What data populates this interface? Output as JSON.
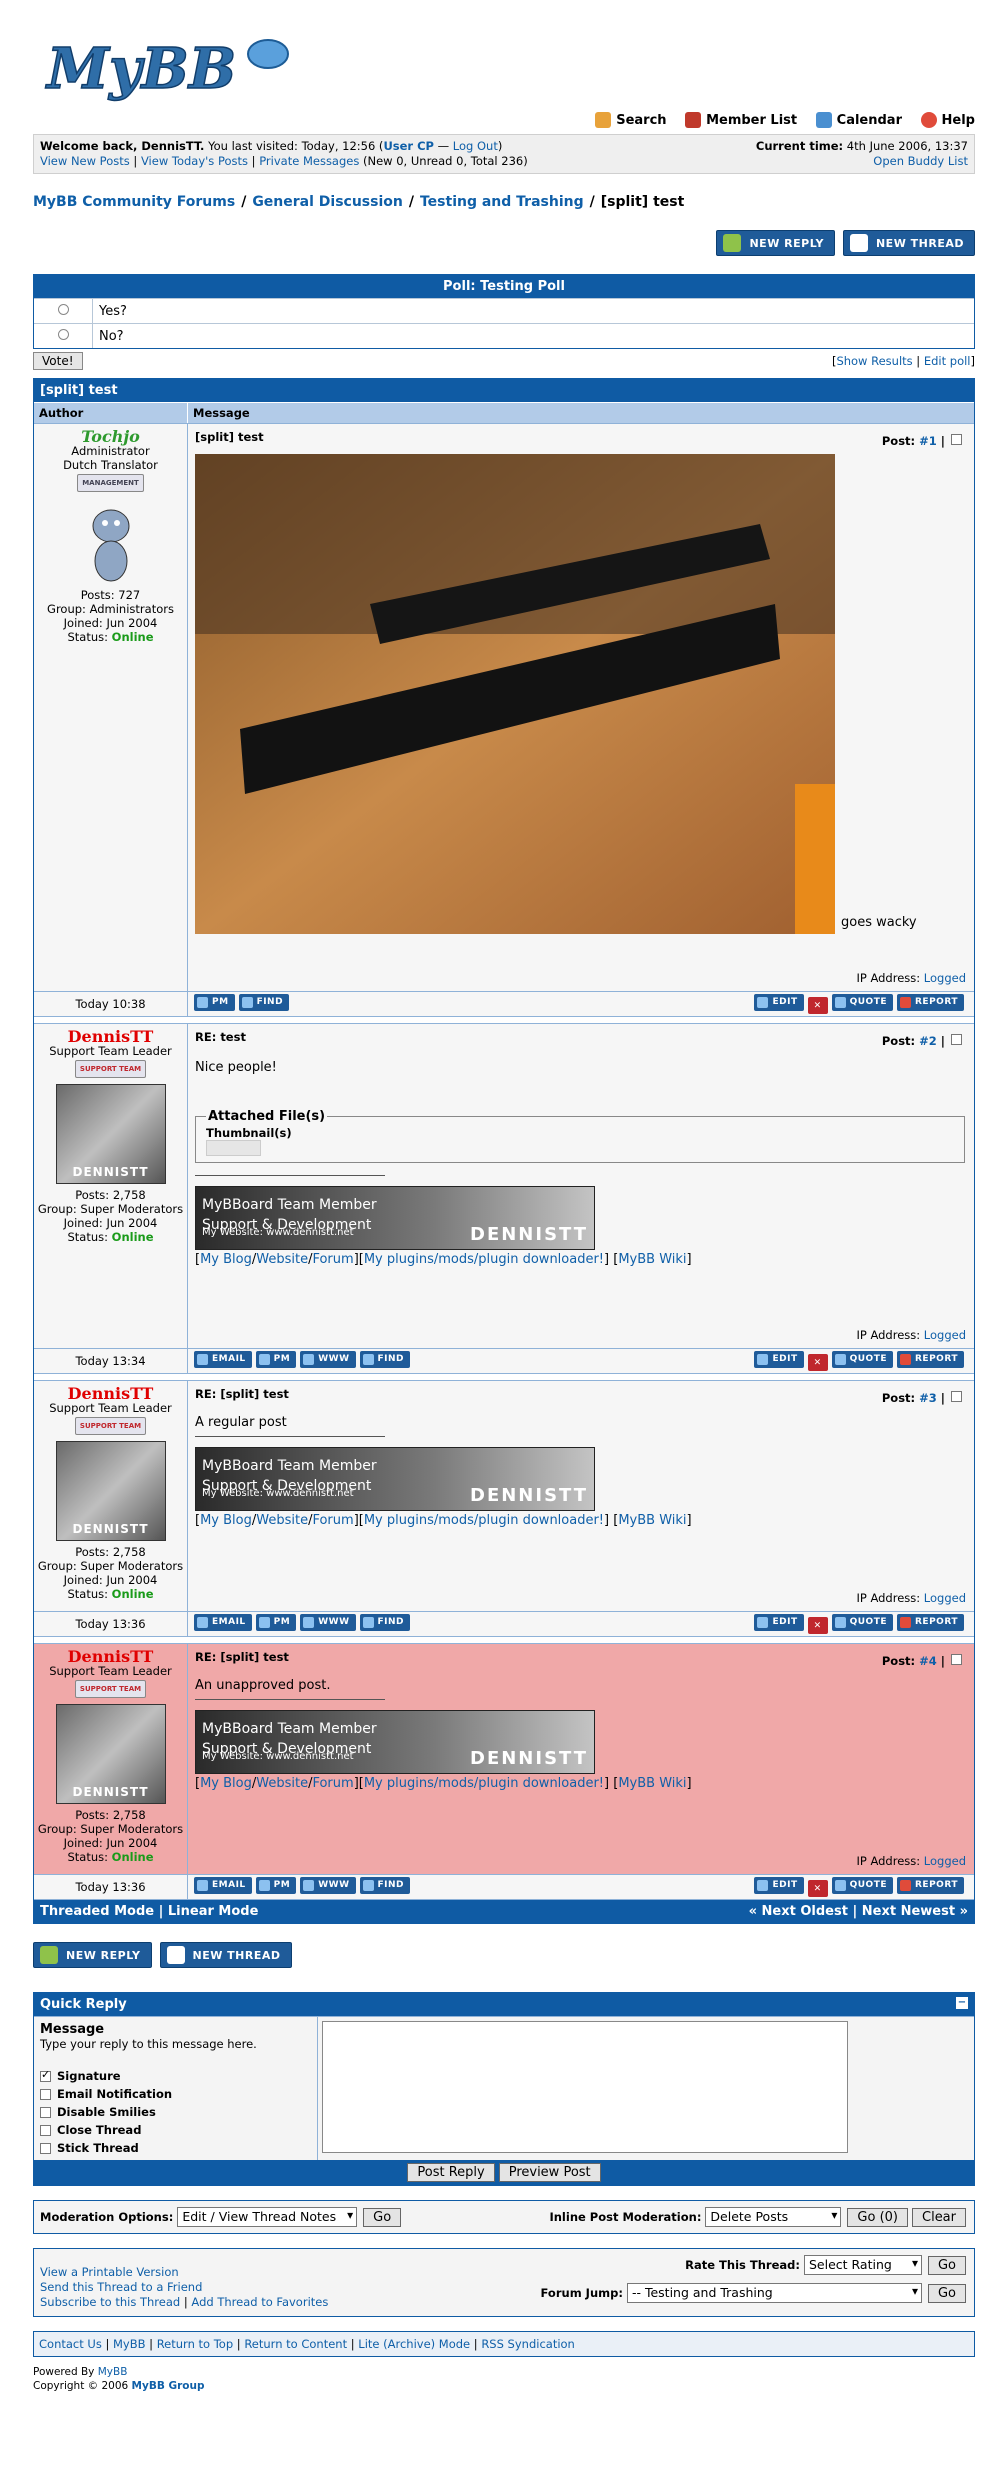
{
  "logo": {
    "text": "MyBB"
  },
  "toplinks": [
    {
      "label": "Search",
      "icon": "search-icon",
      "color": "#e8a23a"
    },
    {
      "label": "Member List",
      "icon": "member-list-icon",
      "color": "#c0392b"
    },
    {
      "label": "Calendar",
      "icon": "calendar-icon",
      "color": "#4a8fd0"
    },
    {
      "label": "Help",
      "icon": "help-icon",
      "color": "#e04b3a"
    }
  ],
  "welcome": {
    "greeting": "Welcome back, DennisTT.",
    "visited": " You last visited: Today, 12:56 (",
    "usercp": "User CP",
    "dash": " — ",
    "logout": "Log Out",
    "close": ")",
    "new_posts": "View New Posts",
    "todays_posts": "View Today's Posts",
    "pm": "Private Messages",
    "pm_counts": "(New 0, Unread 0, Total 236)",
    "time_label": "Current time:",
    "time_value": " 4th June 2006, 13:37",
    "buddy": "Open Buddy List",
    "sep": " | "
  },
  "breadcrumb": {
    "items": [
      "MyBB Community Forums",
      "General Discussion",
      "Testing and Trashing"
    ],
    "current": "[split] test",
    "sep": "/"
  },
  "buttons": {
    "new_reply": "NEW REPLY",
    "new_thread": "NEW THREAD"
  },
  "poll": {
    "title": "Poll: Testing Poll",
    "options": [
      "Yes?",
      "No?"
    ],
    "vote": "Vote!",
    "show_results": "Show Results",
    "edit_poll": "Edit poll",
    "sep": " | ",
    "lb": "[",
    "rb": "]"
  },
  "thread": {
    "title": "[split] test",
    "col_author": "Author",
    "col_message": "Message",
    "ip_label": "IP Address: ",
    "ip_value": "Logged"
  },
  "posts": [
    {
      "author": "Tochjo",
      "title": "Administrator",
      "subtitle": "Dutch Translator",
      "rank": "MANAGEMENT",
      "posts": "Posts: 727",
      "group": "Group: Administrators",
      "joined": "Joined: Jun 2004",
      "status_label": "Status: ",
      "status": "Online",
      "subject": "[split] test",
      "post_label": "Post: ",
      "post_num": "#1",
      "sep": " |",
      "body": "goes wacky",
      "date": "Today 10:38",
      "buttons_left": [
        "PM",
        "FIND"
      ],
      "buttons_right": [
        "EDIT",
        "QUOTE",
        "REPORT"
      ]
    },
    {
      "author": "DennisTT",
      "title": "Support Team Leader",
      "rank": "SUPPORT TEAM",
      "avatar_text": "DENNISTT",
      "posts": "Posts: 2,758",
      "group": "Group: Super Moderators",
      "joined": "Joined: Jun 2004",
      "status_label": "Status: ",
      "status": "Online",
      "subject": "RE: test",
      "post_label": "Post: ",
      "post_num": "#2",
      "sep": " |",
      "body": "Nice people!",
      "attach_legend": "Attached File(s)",
      "thumbs": "Thumbnail(s)",
      "date": "Today 13:34",
      "buttons_left": [
        "EMAIL",
        "PM",
        "WWW",
        "FIND"
      ],
      "buttons_right": [
        "EDIT",
        "QUOTE",
        "REPORT"
      ]
    },
    {
      "author": "DennisTT",
      "title": "Support Team Leader",
      "rank": "SUPPORT TEAM",
      "avatar_text": "DENNISTT",
      "posts": "Posts: 2,758",
      "group": "Group: Super Moderators",
      "joined": "Joined: Jun 2004",
      "status_label": "Status: ",
      "status": "Online",
      "subject": "RE: [split] test",
      "post_label": "Post: ",
      "post_num": "#3",
      "sep": " |",
      "body": "A regular post",
      "date": "Today 13:36",
      "buttons_left": [
        "EMAIL",
        "PM",
        "WWW",
        "FIND"
      ],
      "buttons_right": [
        "EDIT",
        "QUOTE",
        "REPORT"
      ]
    },
    {
      "author": "DennisTT",
      "title": "Support Team Leader",
      "rank": "SUPPORT TEAM",
      "avatar_text": "DENNISTT",
      "posts": "Posts: 2,758",
      "group": "Group: Super Moderators",
      "joined": "Joined: Jun 2004",
      "status_label": "Status: ",
      "status": "Online",
      "subject": "RE: [split] test",
      "post_label": "Post: ",
      "post_num": "#4",
      "sep": " |",
      "body": "An unapproved post.",
      "date": "Today 13:36",
      "buttons_left": [
        "EMAIL",
        "PM",
        "WWW",
        "FIND"
      ],
      "buttons_right": [
        "EDIT",
        "QUOTE",
        "REPORT"
      ]
    }
  ],
  "signature": {
    "line1": "MyBBoard Team Member",
    "line2": "Support & Development",
    "website": "My Website: www.dennistt.net",
    "brand": "DENNISTT",
    "links": [
      "My Blog",
      "Website",
      "Forum",
      "My plugins/mods/plugin downloader!",
      "MyBB Wiki"
    ],
    "lb": "[",
    "rb": "]",
    "slash": "/",
    "mid": "][",
    "space": " "
  },
  "thread_footer": {
    "threaded": "Threaded Mode",
    "linear": "Linear Mode",
    "next_oldest": "« Next Oldest",
    "next_newest": "Next Newest »",
    "sep": " | "
  },
  "quick_reply": {
    "title": "Quick Reply",
    "collapse": "−",
    "message_label": "Message",
    "hint": "Type your reply to this message here.",
    "options": [
      {
        "label": "Signature",
        "checked": true
      },
      {
        "label": "Email Notification",
        "checked": false
      },
      {
        "label": "Disable Smilies",
        "checked": false
      },
      {
        "label": "Close Thread",
        "checked": false
      },
      {
        "label": "Stick Thread",
        "checked": false
      }
    ],
    "post_reply": "Post Reply",
    "preview": "Preview Post"
  },
  "moderation": {
    "label": "Moderation Options:",
    "select": "Edit / View Thread Notes",
    "go": "Go",
    "inline_label": "Inline Post Moderation:",
    "inline_select": "Delete Posts",
    "inline_go": "Go (0)",
    "clear": "Clear"
  },
  "tools": {
    "printable": "View a Printable Version",
    "send": "Send this Thread to a Friend",
    "subscribe": "Subscribe to this Thread",
    "sep": " | ",
    "favorites": "Add Thread to Favorites",
    "rate_label": "Rate This Thread:",
    "rate_select": "Select Rating",
    "go": "Go",
    "jump_label": "Forum Jump:",
    "jump_select": "-- Testing and Trashing"
  },
  "footer": {
    "links": [
      "Contact Us",
      "MyBB",
      "Return to Top",
      "Return to Content",
      "Lite (Archive) Mode",
      "RSS Syndication"
    ],
    "powered": "Powered By ",
    "powered_link": "MyBB",
    "copyright": "Copyright © 2006 ",
    "group": "MyBB Group"
  },
  "colors": {
    "header": "#0f5ba4",
    "unapproved": "#f0a8a8",
    "online": "#1a9b1a",
    "leader": "#e00000",
    "admin": "#2e9a2e"
  }
}
